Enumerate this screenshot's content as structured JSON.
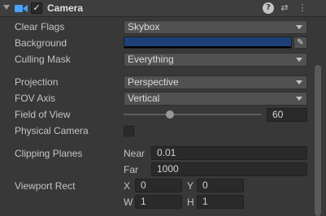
{
  "header": {
    "title": "Camera",
    "enabled": true,
    "check_glyph": "✓",
    "help_glyph": "?",
    "preset_glyph": "⇄",
    "menu_glyph": "⋮"
  },
  "rows": {
    "clear_flags": {
      "label": "Clear Flags",
      "value": "Skybox"
    },
    "background": {
      "label": "Background",
      "color": "#1e4078",
      "eyedropper_glyph": "✎"
    },
    "culling_mask": {
      "label": "Culling Mask",
      "value": "Everything"
    },
    "projection": {
      "label": "Projection",
      "value": "Perspective"
    },
    "fov_axis": {
      "label": "FOV Axis",
      "value": "Vertical"
    },
    "field_of_view": {
      "label": "Field of View",
      "value": "60",
      "slider_value": 60,
      "slider_min": 1e-05,
      "slider_max": 179
    },
    "physical_camera": {
      "label": "Physical Camera",
      "checked": false
    },
    "clipping_planes": {
      "label": "Clipping Planes",
      "near_label": "Near",
      "near_value": "0.01",
      "far_label": "Far",
      "far_value": "1000"
    },
    "viewport_rect": {
      "label": "Viewport Rect",
      "x_label": "X",
      "x_value": "0",
      "y_label": "Y",
      "y_value": "0",
      "w_label": "W",
      "w_value": "1",
      "h_label": "H",
      "h_value": "1"
    }
  },
  "colors": {
    "accent_camera_icon": "#4aa3ff",
    "panel_bg": "#383838"
  }
}
